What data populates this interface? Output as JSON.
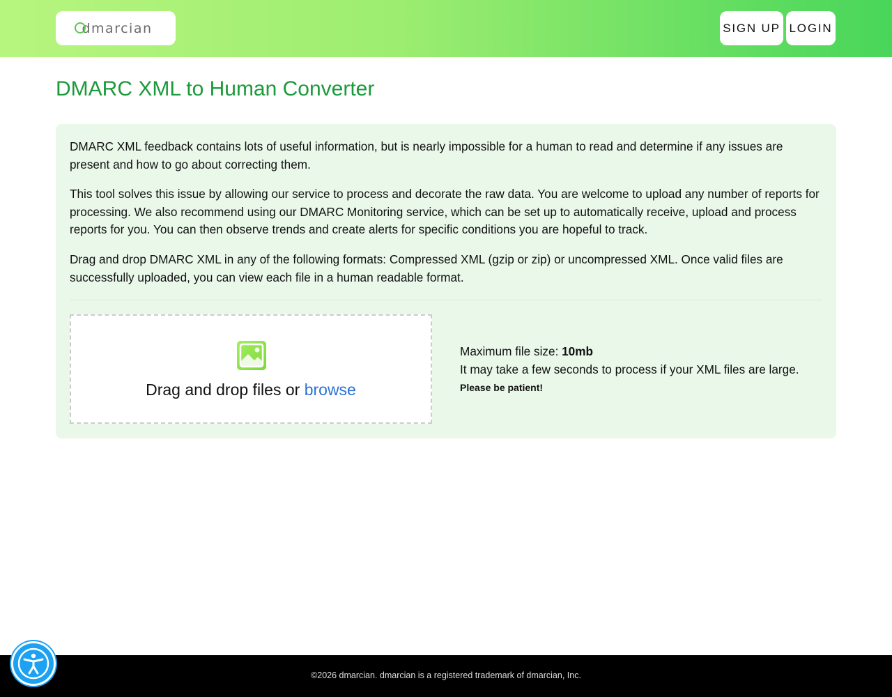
{
  "header": {
    "logo_text": "dmarcian",
    "signup_label": "SIGN UP",
    "login_label": "LOGIN"
  },
  "main": {
    "title": "DMARC XML to Human Converter",
    "paragraphs": [
      "DMARC XML feedback contains lots of useful information, but is nearly impossible for a human to read and determine if any issues are present and how to go about correcting them.",
      "This tool solves this issue by allowing our service to process and decorate the raw data. You are welcome to upload any number of reports for processing. We also recommend using our DMARC Monitoring service, which can be set up to automatically receive, upload and process reports for you. You can then observe trends and create alerts for specific conditions you are hopeful to track.",
      "Drag and drop DMARC XML in any of the following formats: Compressed XML (gzip or zip) or uncompressed XML. Once valid files are successfully uploaded, you can view each file in a human readable format."
    ],
    "dropzone": {
      "text": "Drag and drop files or ",
      "browse_label": "browse"
    },
    "info": {
      "max_size_label": "Maximum file size: ",
      "max_size_value": "10mb",
      "note": "It may take a few seconds to process if your XML files are large.",
      "patient": "Please be patient!"
    }
  },
  "footer": {
    "text": "©2026 dmarcian. dmarcian is a registered trademark of dmarcian, Inc."
  },
  "colors": {
    "title": "#1a9a3a",
    "panel_bg": "#eaf8ea",
    "link": "#2a72d4",
    "header_start": "#b7f57e",
    "header_end": "#48d65a"
  },
  "icons": {
    "upload": "image-icon",
    "accessibility": "accessibility-icon"
  }
}
